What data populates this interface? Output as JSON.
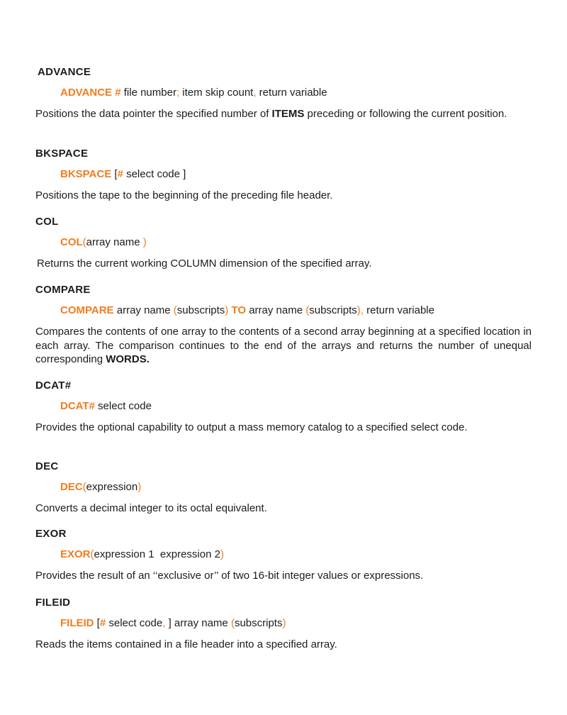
{
  "accent_color": "#ef7d1e",
  "text_color": "#1c1c1c",
  "entries": {
    "advance": {
      "heading": "ADVANCE",
      "syntax": {
        "kw1": "ADVANCE #",
        "t1": " file number",
        "p1": ";",
        "t2": " item skip count",
        "p2": ",",
        "t3": " return variable"
      },
      "desc": {
        "t1": "Positions the data pointer the specified number of ",
        "b1": "ITEMS",
        "t2": " preceding or following the current position."
      }
    },
    "bkspace": {
      "heading": "BKSPACE",
      "syntax": {
        "kw1": "BKSPACE",
        "t1": " [",
        "kw2": "#",
        "t2": " select code ]"
      },
      "desc": "Positions the tape to the beginning of the preceding file header."
    },
    "col": {
      "heading": "COL",
      "syntax": {
        "kw1": "COL",
        "p1": "(",
        "t1": "array name ",
        "p2": ")"
      },
      "desc": "Returns the current working COLUMN dimension of the specified array."
    },
    "compare": {
      "heading": "COMPARE",
      "syntax": {
        "kw1": "COMPARE",
        "t1": " array name ",
        "p1": "(",
        "t2": "subscripts",
        "p2": ")",
        "kw2": " TO",
        "t3": " array name ",
        "p3": "(",
        "t4": "subscripts",
        "p4": "),",
        "t5": " return variable"
      },
      "desc": {
        "t1": "Compares the contents of one array to the contents of a second array beginning at a specified location in each array. The comparison continues to the end of the arrays and returns the number of unequal corresponding ",
        "b1": "WORDS."
      }
    },
    "dcat": {
      "heading": "DCAT#",
      "syntax": {
        "kw1": "DCAT#",
        "t1": " select code"
      },
      "desc": "Provides the optional capability to output a mass memory catalog to a specified select code."
    },
    "dec": {
      "heading": "DEC",
      "syntax": {
        "kw1": "DEC",
        "p1": "(",
        "t1": "expression",
        "p2": ")"
      },
      "desc": "Converts a decimal integer to its octal equivalent."
    },
    "exor": {
      "heading": "EXOR",
      "syntax": {
        "kw1": "EXOR",
        "p1": "(",
        "t1": "expression 1  expression 2",
        "p2": ")"
      },
      "desc": "Provides the result of an ‘‘exclusive or’’ of two 16-bit integer values or expressions."
    },
    "fileid": {
      "heading": "FILEID",
      "syntax": {
        "kw1": "FILEID",
        "t1": " [",
        "kw2": "#",
        "t2": " select code",
        "p1": ",",
        "t3": " ] array name ",
        "p2": "(",
        "t4": "subscripts",
        "p3": ")"
      },
      "desc": "Reads the items contained in a file header into a specified array."
    }
  }
}
